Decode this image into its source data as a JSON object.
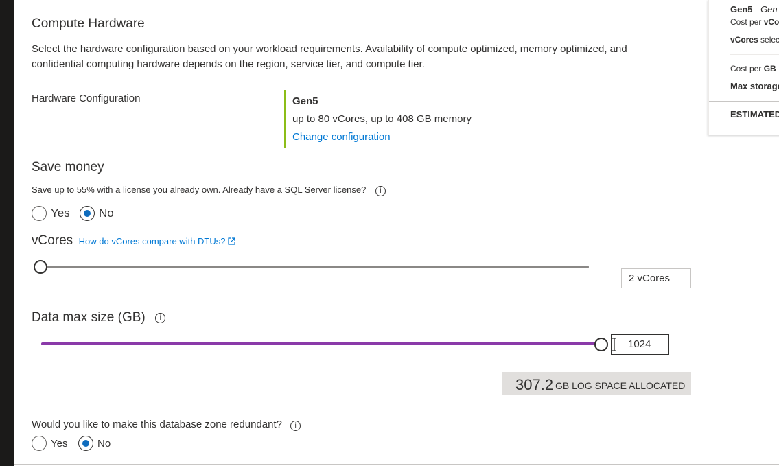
{
  "compute": {
    "title": "Compute Hardware",
    "description_line1": "Select the hardware configuration based on your workload requirements. Availability of compute optimized, memory optimized, and",
    "description_line2": "confidential computing hardware depends on the region, service tier, and compute tier.",
    "hw_label": "Hardware Configuration",
    "hw_name": "Gen5",
    "hw_detail": "up to 80 vCores, up to 408 GB memory",
    "change_link": "Change configuration",
    "accent_color": "#8cbd18"
  },
  "save_money": {
    "title": "Save money",
    "description": "Save up to 55% with a license you already own. Already have a SQL Server license?",
    "info_icon": "info-icon",
    "yes_label": "Yes",
    "no_label": "No",
    "selected": "No"
  },
  "vcores": {
    "title": "vCores",
    "link": "How do vCores compare with DTUs?",
    "link_icon": "external-link-icon",
    "value_text": "2 vCores",
    "slider_fraction": 0.0
  },
  "data_max": {
    "title": "Data max size (GB)",
    "info_icon": "info-icon",
    "value": "1024",
    "slider_fraction": 1.0,
    "slider_color": "#8a3aa9",
    "log_value": "307.2",
    "log_label": "GB LOG SPACE ALLOCATED"
  },
  "zone": {
    "question": "Would you like to make this database zone redundant?",
    "info_icon": "info-icon",
    "yes_label": "Yes",
    "no_label": "No",
    "selected": "No"
  },
  "summary_panel": {
    "gen_bold": "Gen5",
    "gen_rest": " - Gen",
    "cost_vcore_prefix": "Cost per ",
    "cost_vcore_bold": "vCo",
    "vcores_selected_bold": "vCores",
    "vcores_selected_rest": " selec",
    "cost_gb_prefix": "Cost per ",
    "cost_gb_bold": "GB",
    "max_storage": "Max storage",
    "estimated": "ESTIMATED"
  }
}
